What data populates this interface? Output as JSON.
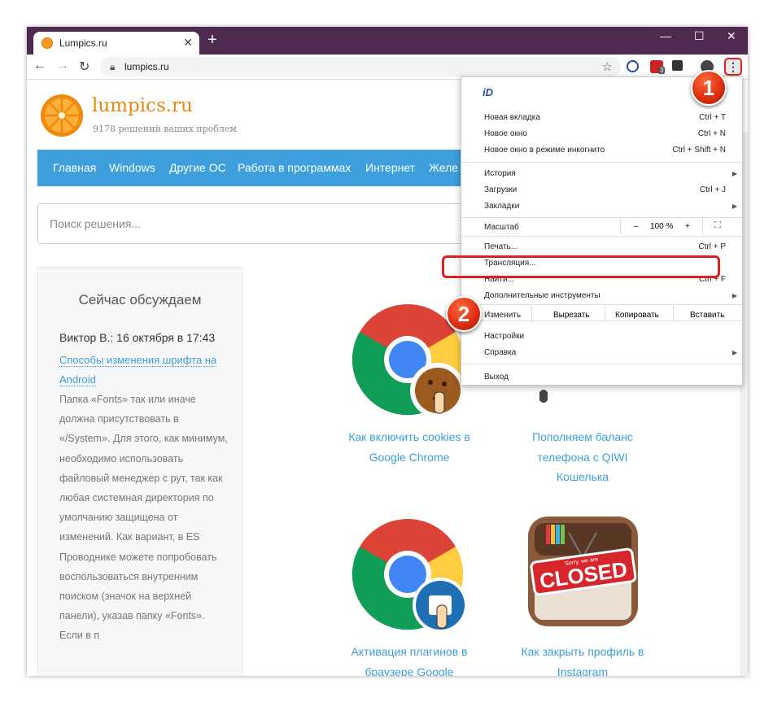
{
  "browser": {
    "tab_title": "Lumpics.ru",
    "url": "lumpics.ru",
    "window_controls": [
      "—",
      "☐",
      "✕"
    ],
    "ext_badge": "3",
    "menu_button_icon": "⋮"
  },
  "site": {
    "brand": "lumpics.ru",
    "tagline": "9178 решений ваших проблем",
    "nav": [
      "Главная",
      "Windows",
      "Другие ОС",
      "Работа в программах",
      "Интернет",
      "Желе"
    ],
    "search_placeholder": "Поиск решения...",
    "sidebar": {
      "heading": "Сейчас обсуждаем",
      "author": "Виктор В.: 16 октября в 17:43",
      "link": "Способы изменения шрифта на Android",
      "text": "Папка «Fonts» так или иначе должна присутствовать в «/System». Для этого, как минимум, необходимо использовать файловый менеджер с рут, так как любая системная директория по умолчанию защищена от изменений. Как вариант, в ES Проводнике можете попробовать воспользоваться внутренним поиском (значок на верхней панели), указав папку «Fonts». Если в п"
    },
    "cards": [
      {
        "caption": "Как включить cookies в Google Chrome"
      },
      {
        "caption": "Пополняем баланс телефона с QIWI Кошелька"
      },
      {
        "caption": "Активация плагинов в браузере Google Chrome"
      },
      {
        "caption": "Как закрыть профиль в Instagram"
      }
    ],
    "closed_sign": {
      "small": "Sorry, we are",
      "big": "CLOSED"
    }
  },
  "menu": {
    "logo": "iD",
    "new_tab": "Новая вкладка",
    "new_tab_sc": "Ctrl + T",
    "new_window": "Новое окно",
    "new_window_sc": "Ctrl + N",
    "incognito": "Новое окно в режиме инкогнито",
    "incognito_sc": "Ctrl + Shift + N",
    "history": "История",
    "downloads": "Загрузки",
    "downloads_sc": "Ctrl + J",
    "bookmarks": "Закладки",
    "zoom": "Масштаб",
    "zoom_minus": "–",
    "zoom_value": "100 %",
    "zoom_plus": "+",
    "print": "Печать...",
    "print_sc": "Ctrl + P",
    "cast": "Трансляция...",
    "find": "Найти...",
    "find_sc": "Ctrl + F",
    "more_tools": "Дополнительные инструменты",
    "edit": "Изменить",
    "cut": "Вырезать",
    "copy": "Копировать",
    "paste": "Вставить",
    "settings": "Настройки",
    "help": "Справка",
    "exit": "Выход"
  },
  "badges": {
    "one": "1",
    "two": "2"
  }
}
